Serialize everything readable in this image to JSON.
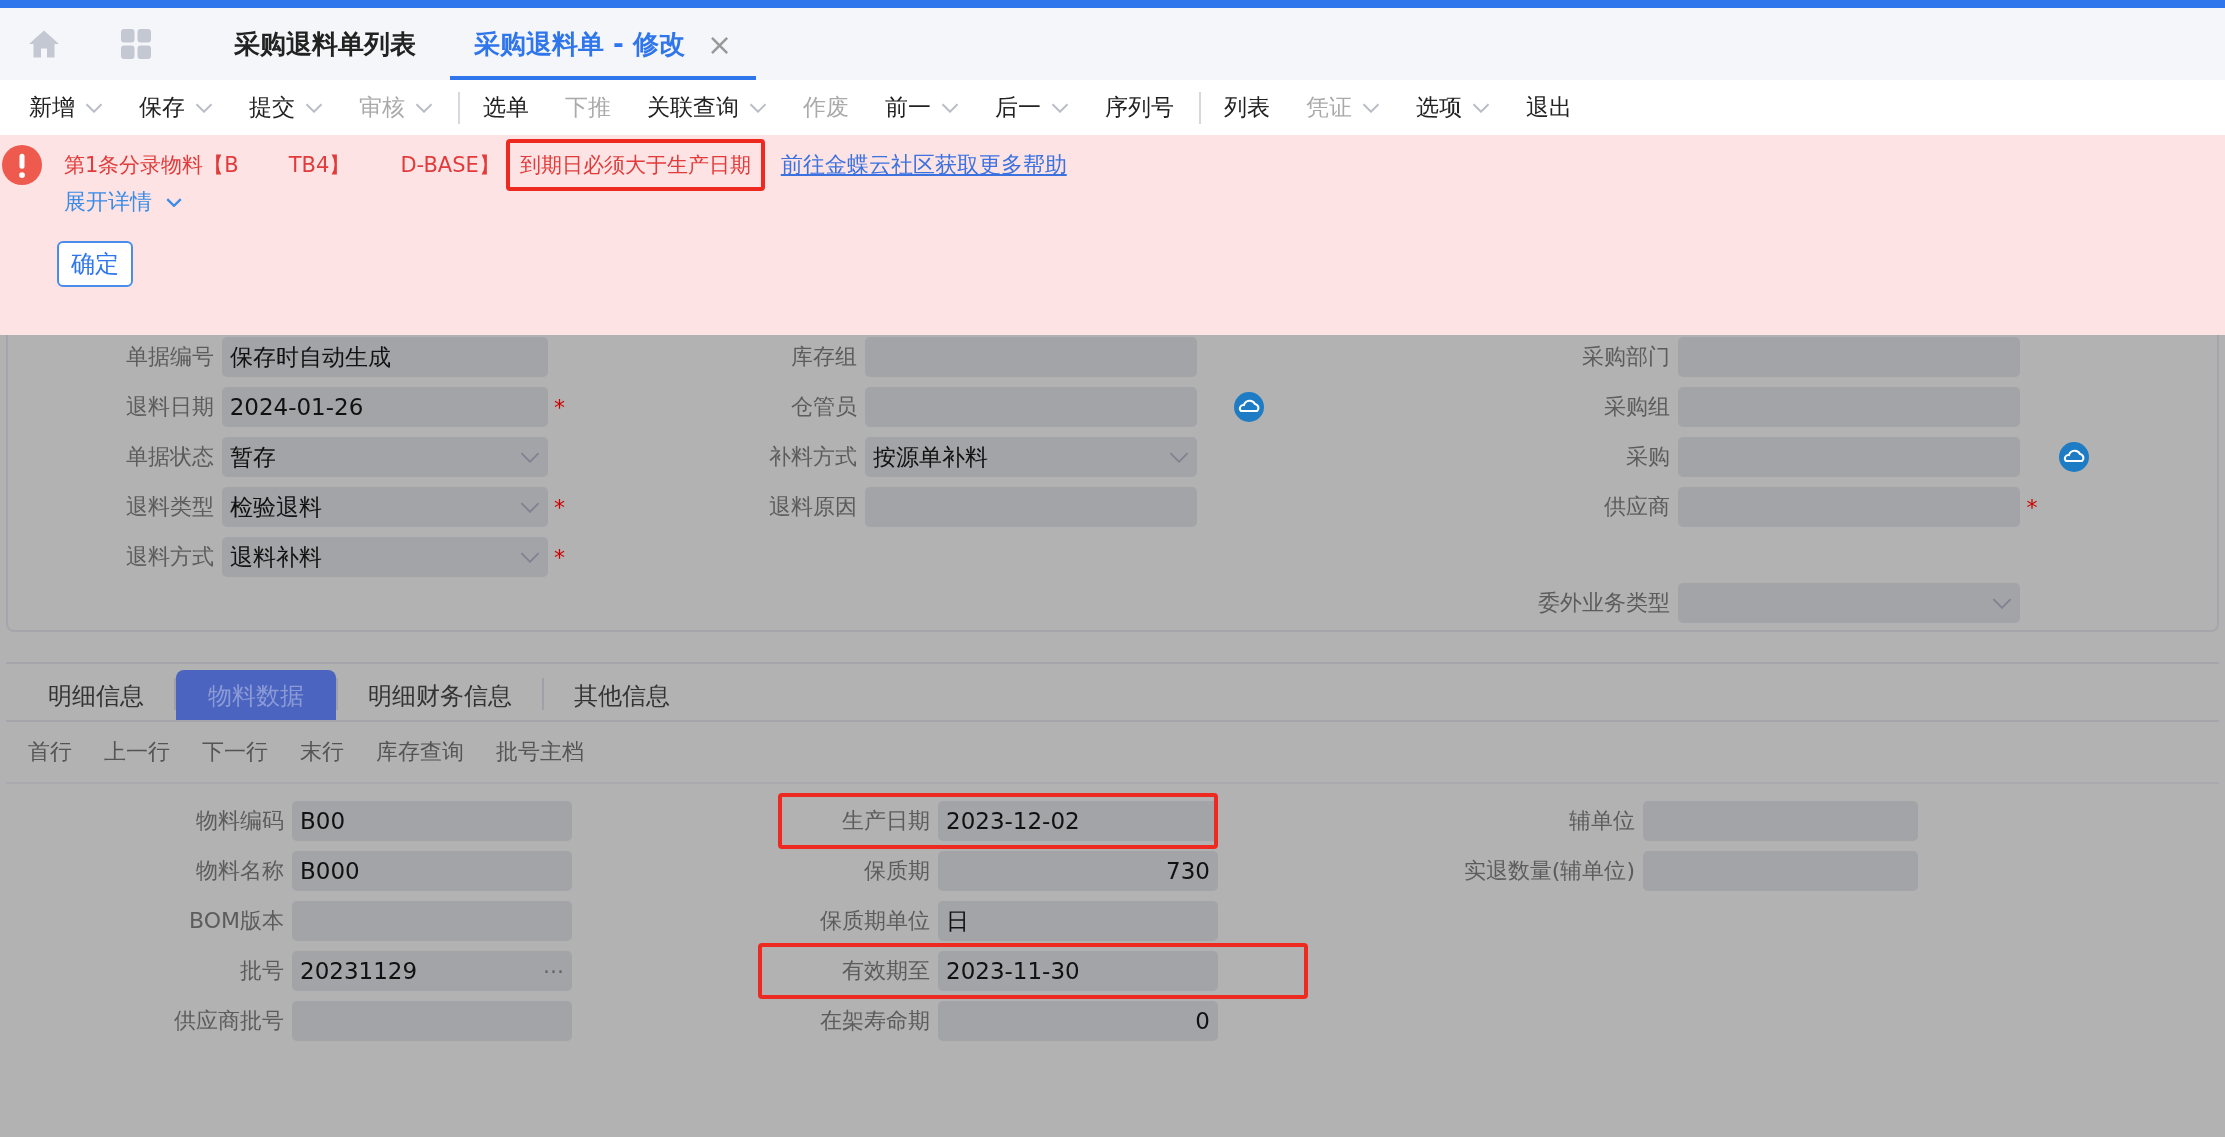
{
  "tabs": [
    {
      "label": "采购退料单列表",
      "selected": false,
      "closable": false
    },
    {
      "label": "采购退料单 - 修改",
      "selected": true,
      "closable": true,
      "close": "×"
    }
  ],
  "toolbar": [
    [
      {
        "label": "新增",
        "dropdown": true,
        "disabled": false
      },
      {
        "label": "保存",
        "dropdown": true,
        "disabled": false
      },
      {
        "label": "提交",
        "dropdown": true,
        "disabled": false
      },
      {
        "label": "审核",
        "dropdown": true,
        "disabled": true
      }
    ],
    [
      {
        "label": "选单",
        "dropdown": false,
        "disabled": false
      },
      {
        "label": "下推",
        "dropdown": false,
        "disabled": true
      },
      {
        "label": "关联查询",
        "dropdown": true,
        "disabled": false
      },
      {
        "label": "作废",
        "dropdown": false,
        "disabled": true
      },
      {
        "label": "前一",
        "dropdown": true,
        "disabled": false
      },
      {
        "label": "后一",
        "dropdown": true,
        "disabled": false
      },
      {
        "label": "序列号",
        "dropdown": false,
        "disabled": false
      }
    ],
    [
      {
        "label": "列表",
        "dropdown": false,
        "disabled": false
      },
      {
        "label": "凭证",
        "dropdown": true,
        "disabled": true
      },
      {
        "label": "选项",
        "dropdown": true,
        "disabled": false
      },
      {
        "label": "退出",
        "dropdown": false,
        "disabled": false
      }
    ]
  ],
  "error": {
    "segments": [
      {
        "text": "第1条分录物料【B",
        "highlighted": false
      },
      {
        "text": "TB4】",
        "highlighted": false
      },
      {
        "text": "D-BASE】",
        "highlighted": false
      },
      {
        "text": "到期日必须大于生产日期",
        "highlighted": true
      }
    ],
    "link": "前往金蝶云社区获取更多帮助",
    "details": "展开详情",
    "confirm": "确定"
  },
  "header_columns": [
    [
      {
        "label": "单据编号",
        "value": "保存时自动生成",
        "kind": "text",
        "cloud_button": false
      },
      {
        "label": "退料日期",
        "value": "2024-01-26",
        "kind": "text",
        "required_mark": "*",
        "cloud_button": false
      },
      {
        "label": "单据状态",
        "value": "暂存",
        "kind": "select",
        "cloud_button": false
      },
      {
        "label": "退料类型",
        "value": "检验退料",
        "kind": "select",
        "required_mark": "*",
        "cloud_button": false
      },
      {
        "label": "退料方式",
        "value": "退料补料",
        "kind": "select",
        "required_mark": "*",
        "cloud_button": false
      }
    ],
    [
      {
        "label": "库存组",
        "kind": "text",
        "cloud_button": false
      },
      {
        "label": "仓管员",
        "kind": "text",
        "cloud_button": true
      },
      {
        "label": "补料方式",
        "value": "按源单补料",
        "kind": "select",
        "cloud_button": false
      },
      {
        "label": "退料原因",
        "kind": "text",
        "cloud_button": false
      }
    ],
    [
      {
        "label": "采购部门",
        "kind": "text",
        "cloud_button": false
      },
      {
        "label": "采购组",
        "kind": "text",
        "cloud_button": false
      },
      {
        "label": "采购",
        "kind": "text",
        "cloud_button": true
      },
      {
        "label": "供应商",
        "kind": "text",
        "required_mark": "*",
        "cloud_button": false
      },
      {
        "label": "委外业务类型",
        "kind": "select",
        "cloud_button": false
      }
    ]
  ],
  "detail_tabs": [
    {
      "label": "明细信息",
      "selected": false
    },
    {
      "label": "物料数据",
      "selected": true
    },
    {
      "label": "明细财务信息",
      "selected": false
    },
    {
      "label": "其他信息",
      "selected": false
    }
  ],
  "row_actions": [
    "首行",
    "上一行",
    "下一行",
    "末行",
    "库存查询",
    "批号主档"
  ],
  "detail_columns": [
    [
      {
        "label": "物料编码",
        "value": "B00",
        "kind": "text",
        "highlighted": false
      },
      {
        "label": "物料名称",
        "value": "B000",
        "kind": "text",
        "highlighted": false
      },
      {
        "label": "BOM版本",
        "kind": "text",
        "highlighted": false
      },
      {
        "label": "批号",
        "value": "20231129",
        "kind": "lookup",
        "button": "···",
        "highlighted": false
      },
      {
        "label": "供应商批号",
        "kind": "text",
        "highlighted": false
      }
    ],
    [
      {
        "label": "生产日期",
        "value": "2023-12-02",
        "kind": "text",
        "highlighted": true
      },
      {
        "label": "保质期",
        "value": "730",
        "kind": "number",
        "highlighted": false
      },
      {
        "label": "保质期单位",
        "value": "日",
        "kind": "text",
        "highlighted": false
      },
      {
        "label": "有效期至",
        "value": "2023-11-30",
        "kind": "text",
        "highlighted": true
      },
      {
        "label": "在架寿命期",
        "value": "0",
        "kind": "number",
        "highlighted": false
      }
    ],
    [
      {
        "label": "辅单位",
        "kind": "text",
        "highlighted": false
      },
      {
        "label": "实退数量(辅单位)",
        "kind": "text",
        "highlighted": false
      }
    ]
  ]
}
